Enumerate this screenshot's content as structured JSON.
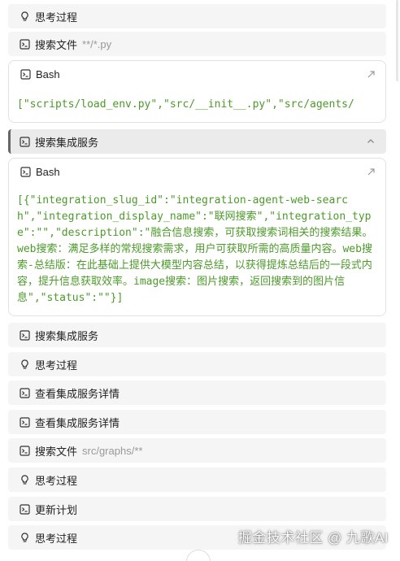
{
  "steps": {
    "s1": {
      "label": "思考过程",
      "icon": "lightbulb-icon"
    },
    "s2": {
      "label": "搜索文件",
      "arg": "**/*.py",
      "icon": "terminal-icon"
    },
    "s3": {
      "label": "搜索集成服务",
      "icon": "terminal-icon"
    },
    "s4": {
      "label": "搜索集成服务",
      "icon": "terminal-icon"
    },
    "s5": {
      "label": "思考过程",
      "icon": "lightbulb-icon"
    },
    "s6": {
      "label": "查看集成服务详情",
      "icon": "terminal-icon"
    },
    "s7": {
      "label": "查看集成服务详情",
      "icon": "terminal-icon"
    },
    "s8": {
      "label": "搜索文件",
      "arg": "src/graphs/**",
      "icon": "terminal-icon"
    },
    "s9": {
      "label": "思考过程",
      "icon": "lightbulb-icon"
    },
    "s10": {
      "label": "更新计划",
      "icon": "terminal-icon"
    },
    "s11": {
      "label": "思考过程",
      "icon": "lightbulb-icon"
    }
  },
  "card1": {
    "title": "Bash",
    "output": "[\"scripts/load_env.py\",\"src/__init__.py\",\"src/agents/"
  },
  "card2": {
    "title": "Bash",
    "output": "[{\"integration_slug_id\":\"integration-agent-web-search\",\"integration_display_name\":\"联网搜索\",\"integration_type\":\"\",\"description\":\"融合信息搜索，可获取搜索词相关的搜索结果。web搜索：满足多样的常规搜索需求，用户可获取所需的高质量内容。web搜索-总结版：在此基础上提供大模型内容总结，以获得提炼总结后的一段式内容，提升信息获取效率。image搜索：图片搜索，返回搜索到的图片信息\",\"status\":\"\"}]"
  },
  "watermark": "掘金技术社区 @ 九歌AI",
  "colors": {
    "code_green": "#4c9a2a",
    "step_bg": "#f5f5f5",
    "active_step_bg": "#ebebeb",
    "card_border": "#e2e2e2"
  }
}
